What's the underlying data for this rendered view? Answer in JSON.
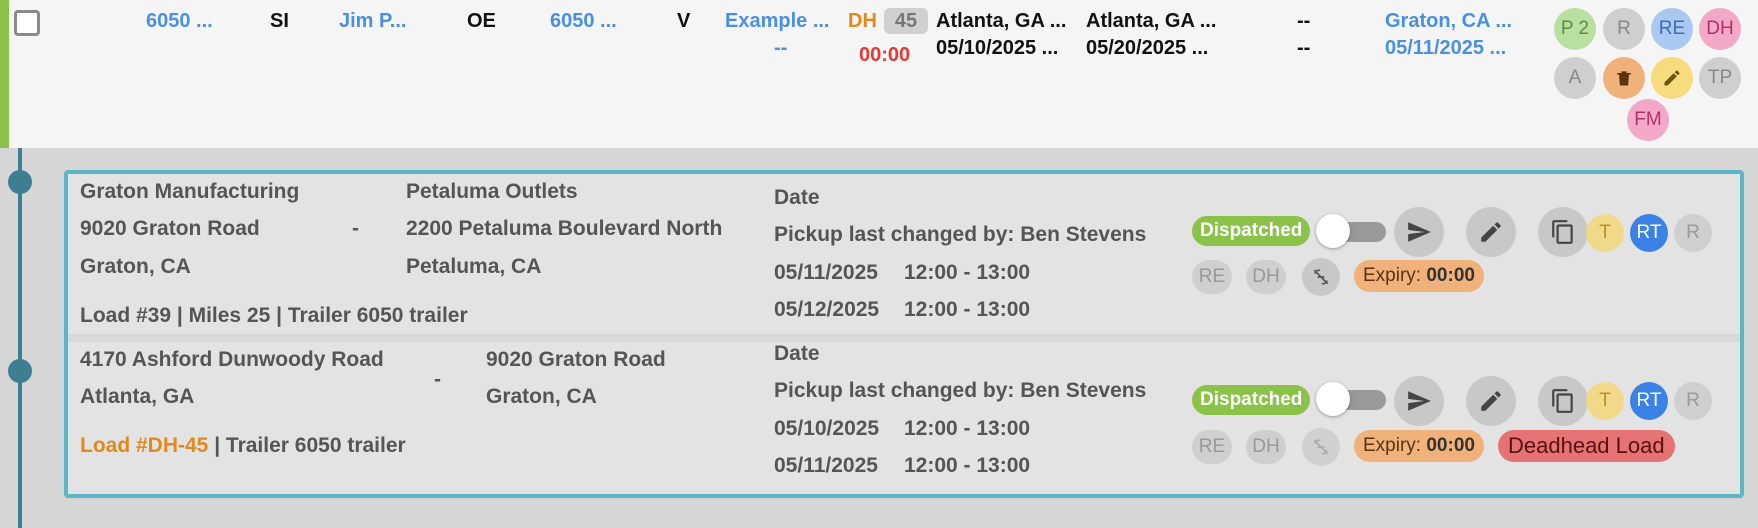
{
  "row": {
    "c1": "6050 ...",
    "c2": "SI",
    "c3": "Jim P...",
    "c4": "OE",
    "c5": "6050 ...",
    "c6": "V",
    "c7": "Example ...",
    "c7b": "--",
    "dh_label": "DH",
    "dh_count": "45",
    "dh_time": "00:00",
    "pickup_city": "Atlanta, GA ...",
    "pickup_date": "05/10/2025 ...",
    "delivery_city": "Atlanta, GA ...",
    "delivery_date": "05/20/2025 ...",
    "dash1": "--",
    "dash2": "--",
    "dest_city": "Graton, CA ...",
    "dest_date": "05/11/2025 ...",
    "badges": {
      "p2": "P 2",
      "r": "R",
      "re": "RE",
      "dh": "DH",
      "a": "A",
      "tp": "TP",
      "fm": "FM"
    }
  },
  "stops": [
    {
      "origin_name": "Graton Manufacturing",
      "origin_addr": "9020 Graton Road",
      "origin_city": "Graton, CA",
      "separator": "-",
      "dest_name": "Petaluma Outlets",
      "dest_addr": "2200 Petaluma Boulevard North",
      "dest_city": "Petaluma, CA",
      "info": "Load #39 | Miles 25 | Trailer 6050 trailer",
      "date_label": "Date",
      "changed_by": "Pickup last changed by: Ben Stevens",
      "date1": "05/11/2025",
      "time1": "12:00 - 13:00",
      "date2": "05/12/2025",
      "time2": "12:00 - 13:00",
      "status": "Dispatched",
      "expiry_label": "Expiry:",
      "expiry_value": "00:00",
      "chips": {
        "t": "T",
        "rt": "RT",
        "r": "R",
        "re": "RE",
        "dh": "DH"
      }
    },
    {
      "origin_addr": "4170 Ashford Dunwoody Road",
      "origin_city": "Atlanta, GA",
      "separator": "-",
      "dest_addr": "9020 Graton Road",
      "dest_city": "Graton, CA",
      "load_link": "Load #DH-45",
      "info": "| Trailer 6050 trailer",
      "date_label": "Date",
      "changed_by": "Pickup last changed by: Ben Stevens",
      "date1": "05/10/2025",
      "time1": "12:00 - 13:00",
      "date2": "05/11/2025",
      "time2": "12:00 - 13:00",
      "status": "Dispatched",
      "expiry_label": "Expiry:",
      "expiry_value": "00:00",
      "deadhead": "Deadhead Load",
      "chips": {
        "t": "T",
        "rt": "RT",
        "r": "R",
        "re": "RE",
        "dh": "DH"
      }
    }
  ],
  "colors": {
    "accent_blue": "#4a90e2",
    "status_green": "#8bc34a",
    "panel_border": "#5bb5c4",
    "timeline": "#3d7f91"
  }
}
